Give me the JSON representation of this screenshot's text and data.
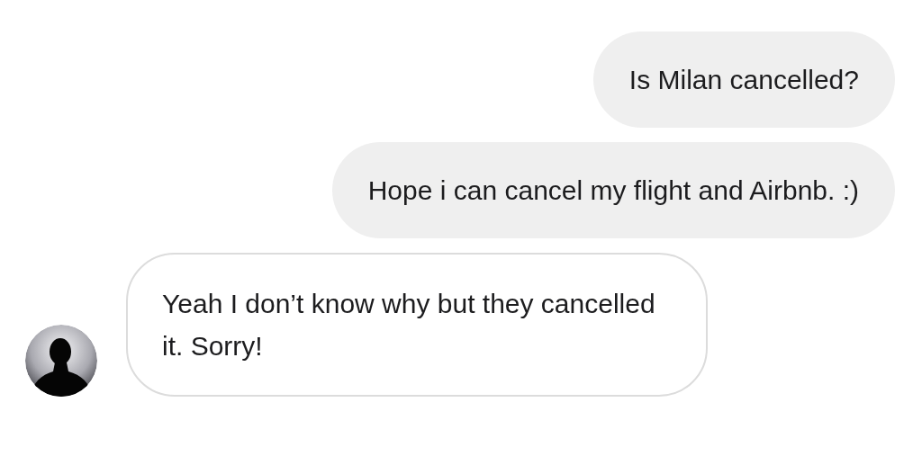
{
  "messages": [
    {
      "kind": "outgoing",
      "text": "Is Milan cancelled?"
    },
    {
      "kind": "outgoing",
      "text": "Hope i can cancel my flight and Airbnb. :)"
    },
    {
      "kind": "incoming",
      "text": "Yeah I don’t know why but they cancelled it. Sorry!"
    }
  ]
}
